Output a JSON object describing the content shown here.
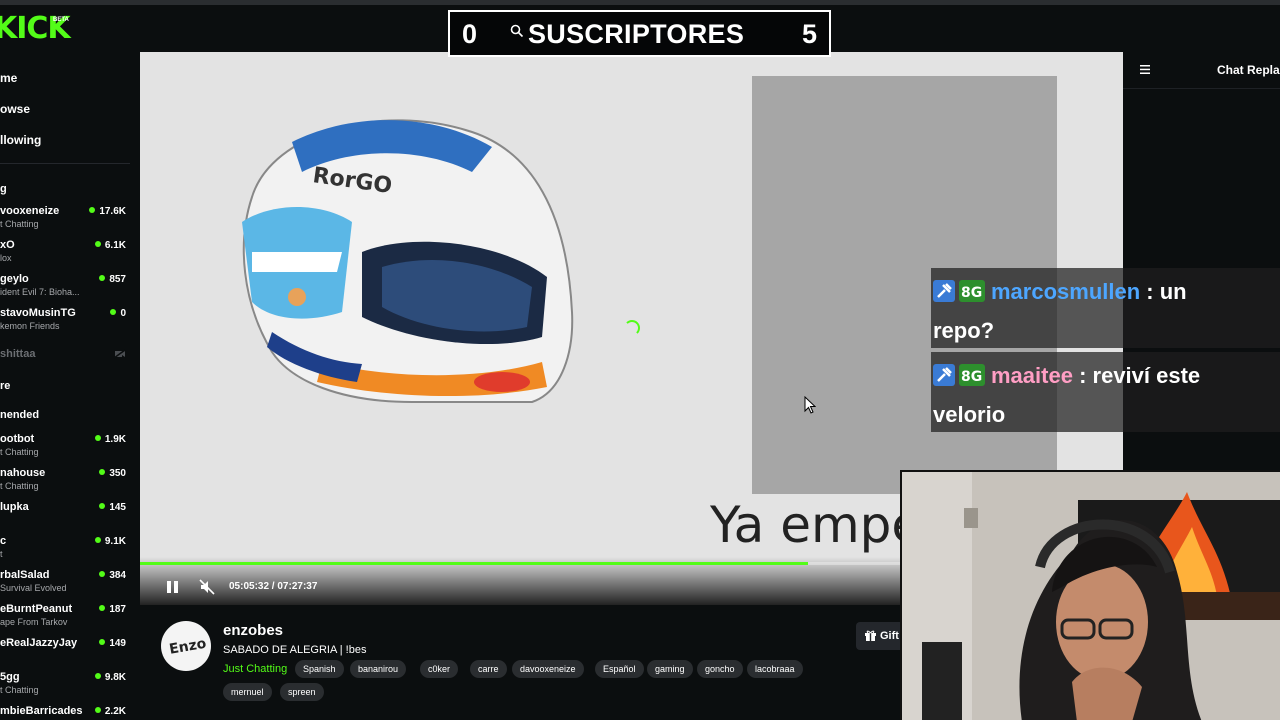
{
  "brand": {
    "logo": "KICK",
    "beta": "BETA"
  },
  "overlay_counter": {
    "left_value": "0",
    "label": "SUSCRIPTORES",
    "right_value": "5"
  },
  "sidebar": {
    "nav": [
      "me",
      "owse",
      "llowing"
    ],
    "following_label": "g",
    "following": [
      {
        "name": "vooxeneize",
        "category": "t Chatting",
        "viewers": "17.6K",
        "live": true
      },
      {
        "name": "xO",
        "category": "lox",
        "viewers": "6.1K",
        "live": true
      },
      {
        "name": "geylo",
        "category": "ident Evil 7: Bioha...",
        "viewers": "857",
        "live": true
      },
      {
        "name": "stavoMusinTG",
        "category": "kemon Friends",
        "viewers": "0",
        "live": true
      },
      {
        "name": "shittaa",
        "category": "",
        "viewers": "",
        "live": false
      }
    ],
    "more_label": "re",
    "recommended_label": "nended",
    "recommended": [
      {
        "name": "ootbot",
        "category": "t Chatting",
        "viewers": "1.9K"
      },
      {
        "name": "nahouse",
        "category": "t Chatting",
        "viewers": "350"
      },
      {
        "name": "lupka",
        "category": "",
        "viewers": "145"
      },
      {
        "name": "c",
        "category": "t",
        "viewers": "9.1K"
      },
      {
        "name": "rbalSalad",
        "category": "Survival Evolved",
        "viewers": "384"
      },
      {
        "name": "eBurntPeanut",
        "category": "ape From Tarkov",
        "viewers": "187"
      },
      {
        "name": "eRealJazzyJay",
        "category": "",
        "viewers": "149"
      },
      {
        "name": "5gg",
        "category": "t Chatting",
        "viewers": "9.8K"
      },
      {
        "name": "mbieBarricades",
        "category": "",
        "viewers": "2.2K"
      }
    ]
  },
  "video": {
    "overlay_text": "Ya empe",
    "time": "05:05:32 / 07:27:37",
    "progress": 0.68
  },
  "chat": {
    "title": "Chat Repla",
    "messages": [
      {
        "user": "marcosmullen",
        "sep": " : ",
        "text_line1": "un",
        "text_line2": "repo?"
      },
      {
        "user": "maaitee",
        "sep": " : ",
        "text_line1": "reviví este",
        "text_line2": "velorio"
      }
    ]
  },
  "stream": {
    "streamer": "enzobes",
    "title": "SABADO DE ALEGRIA | !bes",
    "category": "Just Chatting",
    "tags": [
      "Spanish",
      "bananirou",
      "c0ker",
      "carre",
      "davooxeneize",
      "Español",
      "gaming",
      "goncho",
      "lacobraaa",
      "mernuel",
      "spreen"
    ],
    "gift_label": "Gift"
  },
  "colors": {
    "accent": "#53fc18",
    "background": "#0b0e0f",
    "user1": "#4da6ff",
    "user2": "#ff9ec4"
  }
}
